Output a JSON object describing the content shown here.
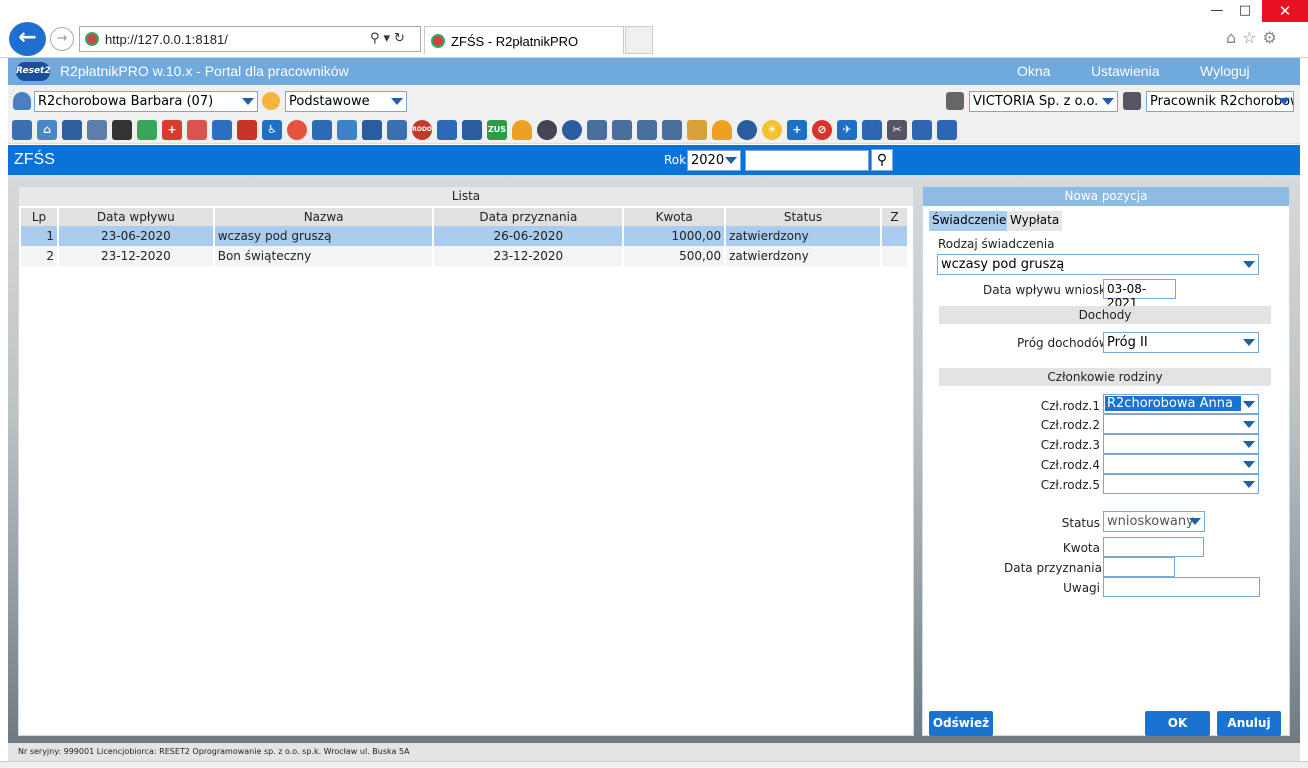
{
  "browser": {
    "address": "http://127.0.0.1:8181/",
    "tab_title": "ZFŚS - R2płatnikPRO"
  },
  "app": {
    "logo_text": "Reset2",
    "title": "R2płatnikPRO w.10.x - Portal dla pracowników",
    "menu": [
      "Okna",
      "Ustawienia",
      "Wyloguj"
    ]
  },
  "selectors": {
    "employee": "R2chorobowa Barbara (07)",
    "profile": "Podstawowe",
    "company": "VICTORIA Sp. z o.o.",
    "role": "Pracownik R2chorobowa"
  },
  "toolbar": {
    "rodo_label": "RODO",
    "zus_label": "ZUS"
  },
  "module": {
    "title": "ZFŚS",
    "year_label": "Rok",
    "year": "2020",
    "search_value": ""
  },
  "list": {
    "title": "Lista",
    "columns": [
      "Lp",
      "Data wpływu",
      "Nazwa",
      "Data przyznania",
      "Kwota",
      "Status",
      "Z"
    ],
    "rows": [
      {
        "lp": "1",
        "data_wplywu": "23-06-2020",
        "nazwa": "wczasy pod gruszą",
        "data_przyznania": "26-06-2020",
        "kwota": "1000,00",
        "status": "zatwierdzony",
        "z": ""
      },
      {
        "lp": "2",
        "data_wplywu": "23-12-2020",
        "nazwa": "Bon świąteczny",
        "data_przyznania": "23-12-2020",
        "kwota": "500,00",
        "status": "zatwierdzony",
        "z": ""
      }
    ]
  },
  "form": {
    "title": "Nowa pozycja",
    "tabs": [
      "Świadczenie",
      "Wypłata"
    ],
    "rodzaj_label": "Rodzaj świadczenia",
    "rodzaj_value": "wczasy pod gruszą",
    "data_wplywu_label": "Data wpływu wniosku",
    "data_wplywu_value": "03-08-2021",
    "dochody_header": "Dochody",
    "prog_label": "Próg dochodów",
    "prog_value": "Próg II",
    "czlonkowie_header": "Członkowie rodziny",
    "members": [
      {
        "label": "Czł.rodz.1",
        "value": "R2chorobowa Anna"
      },
      {
        "label": "Czł.rodz.2",
        "value": ""
      },
      {
        "label": "Czł.rodz.3",
        "value": ""
      },
      {
        "label": "Czł.rodz.4",
        "value": ""
      },
      {
        "label": "Czł.rodz.5",
        "value": ""
      }
    ],
    "status_label": "Status",
    "status_value": "wnioskowany",
    "kwota_label": "Kwota",
    "kwota_value": "",
    "data_przyznania_label": "Data przyznania",
    "data_przyznania_value": "",
    "uwagi_label": "Uwagi",
    "uwagi_value": "",
    "refresh_label": "Odśwież",
    "ok_label": "OK",
    "cancel_label": "Anuluj"
  },
  "footer": "Nr seryjny: 999001 Licencjobiorca: RESET2 Oprogramowanie sp. z o.o. sp.k. Wrocław ul. Buska 5A"
}
